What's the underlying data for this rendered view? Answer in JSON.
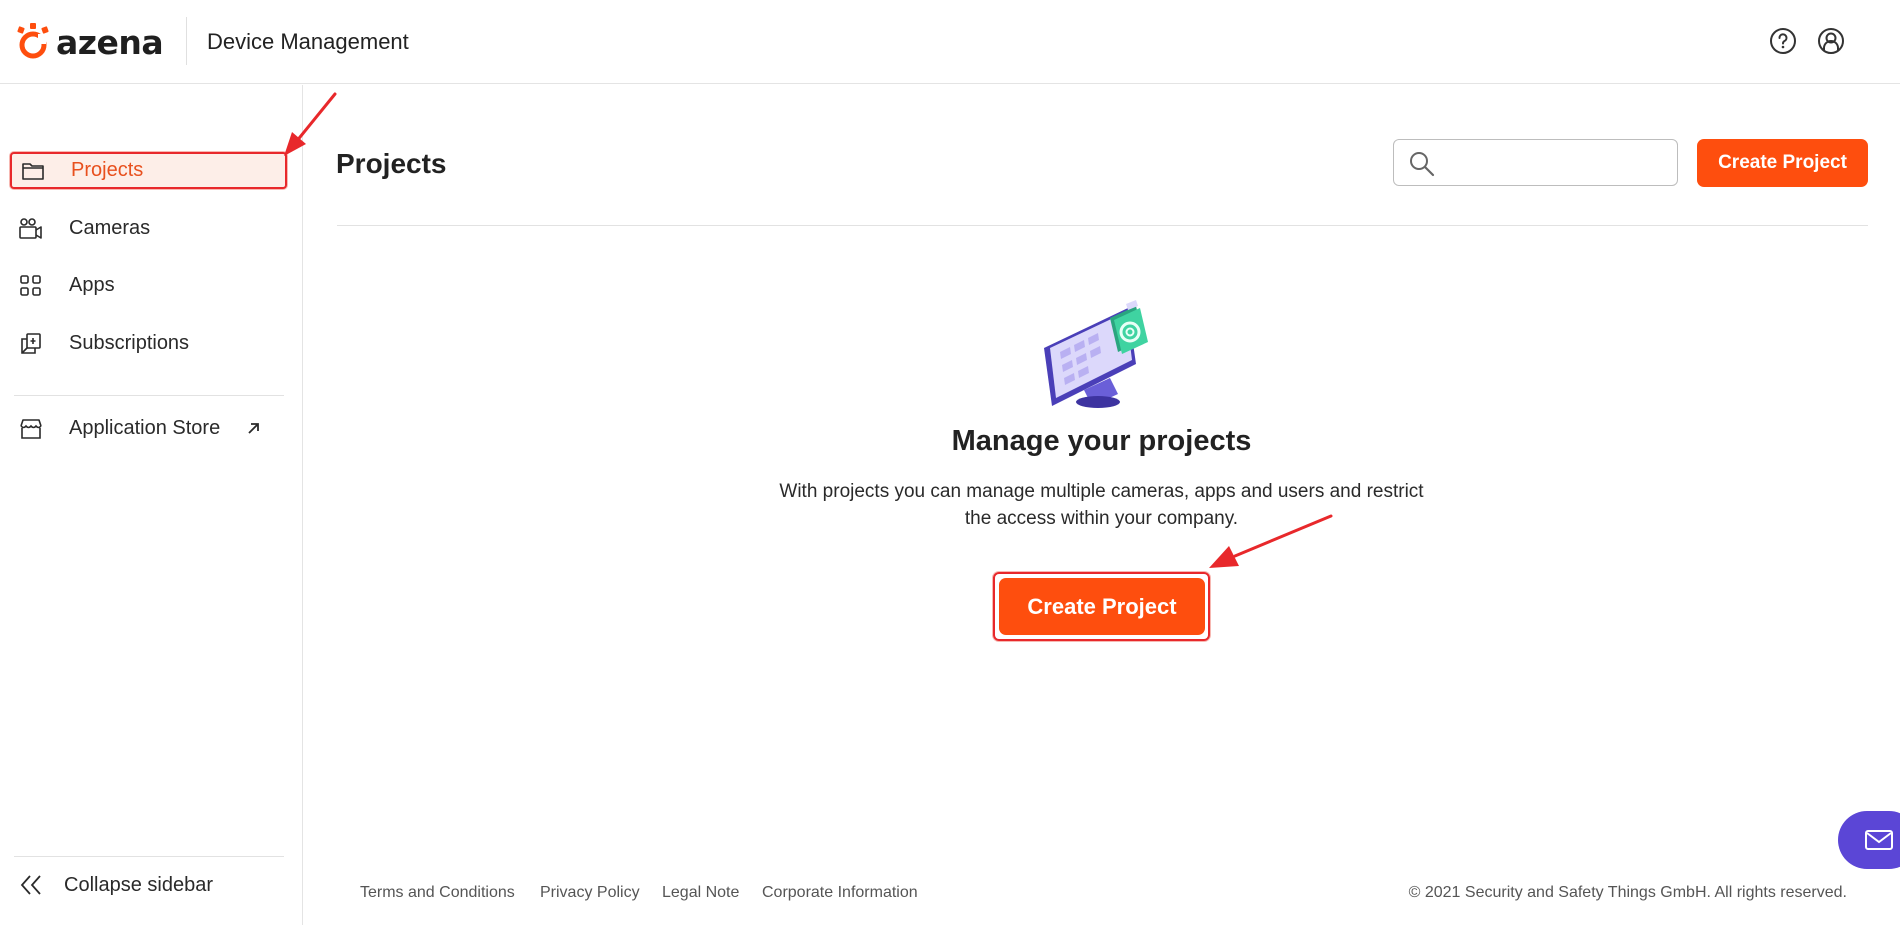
{
  "header": {
    "logo_text": "azena",
    "app_title": "Device Management",
    "help_icon": "help-circle-icon",
    "user_icon": "user-circle-icon"
  },
  "sidebar": {
    "items": [
      {
        "label": "Projects",
        "icon": "folder-icon",
        "active": true
      },
      {
        "label": "Cameras",
        "icon": "cameras-icon",
        "active": false
      },
      {
        "label": "Apps",
        "icon": "apps-grid-icon",
        "active": false
      },
      {
        "label": "Subscriptions",
        "icon": "subscriptions-icon",
        "active": false
      },
      {
        "label": "Application Store",
        "icon": "store-icon",
        "external": true
      }
    ],
    "collapse_label": "Collapse sidebar"
  },
  "main": {
    "title": "Projects",
    "search": {
      "placeholder": "",
      "value": ""
    },
    "create_button": "Create Project",
    "empty_state": {
      "title": "Manage your projects",
      "description_line1": "With projects you can manage multiple cameras, apps and users and restrict",
      "description_line2": "the access within your company.",
      "button": "Create Project"
    }
  },
  "footer": {
    "links": [
      "Terms and Conditions",
      "Privacy Policy",
      "Legal Note",
      "Corporate Information"
    ],
    "copyright": "© 2021 Security and Safety Things GmbH. All rights reserved."
  },
  "colors": {
    "accent": "#fe4e0e",
    "annotation": "#e8282b",
    "fab": "#5b46d6"
  }
}
